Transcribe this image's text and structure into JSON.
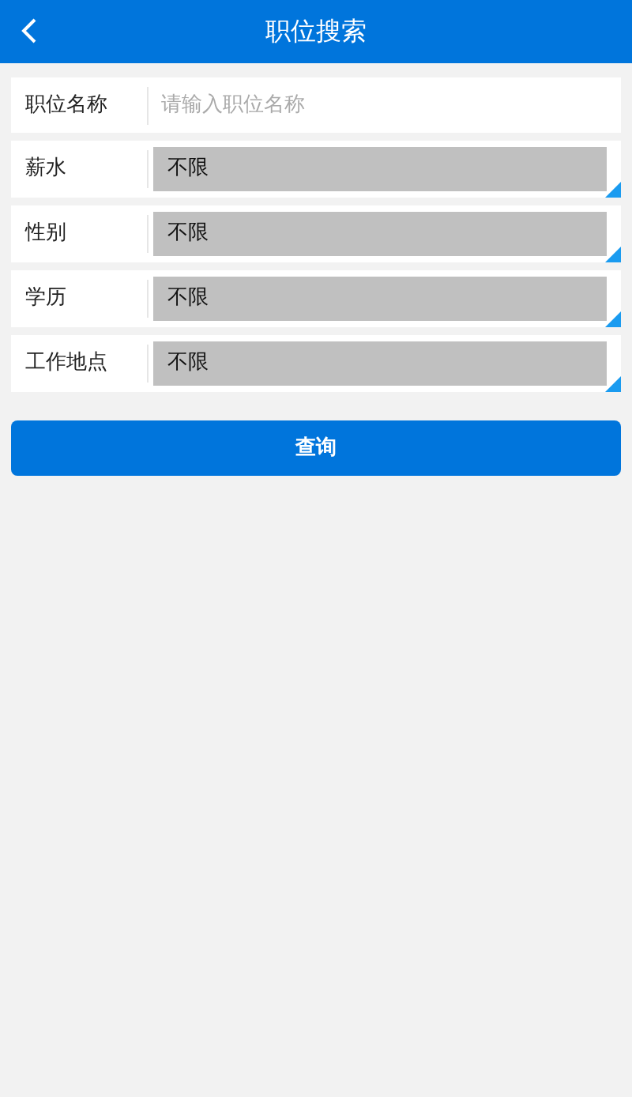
{
  "header": {
    "title": "职位搜索"
  },
  "fields": [
    {
      "kind": "text",
      "label": "职位名称",
      "placeholder": "请输入职位名称"
    },
    {
      "kind": "select",
      "label": "薪水",
      "value": "不限"
    },
    {
      "kind": "select",
      "label": "性别",
      "value": "不限"
    },
    {
      "kind": "select",
      "label": "学历",
      "value": "不限"
    },
    {
      "kind": "select",
      "label": "工作地点",
      "value": "不限"
    }
  ],
  "button": "查询"
}
